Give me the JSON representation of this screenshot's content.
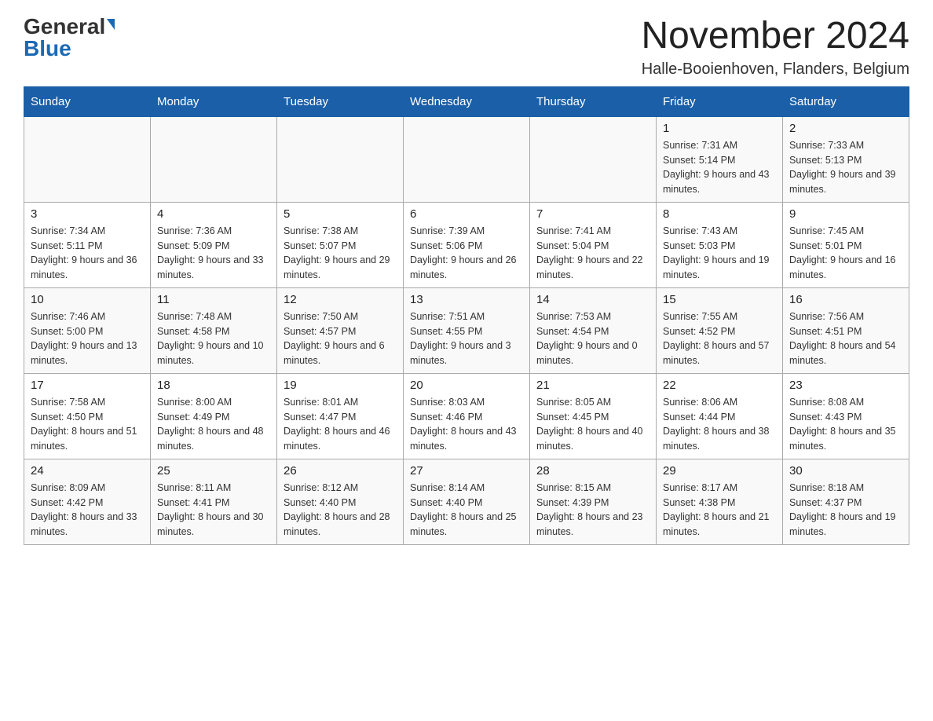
{
  "header": {
    "logo_general": "General",
    "logo_blue": "Blue",
    "month_title": "November 2024",
    "location": "Halle-Booienhoven, Flanders, Belgium"
  },
  "weekdays": [
    "Sunday",
    "Monday",
    "Tuesday",
    "Wednesday",
    "Thursday",
    "Friday",
    "Saturday"
  ],
  "weeks": [
    [
      {
        "day": "",
        "info": ""
      },
      {
        "day": "",
        "info": ""
      },
      {
        "day": "",
        "info": ""
      },
      {
        "day": "",
        "info": ""
      },
      {
        "day": "",
        "info": ""
      },
      {
        "day": "1",
        "info": "Sunrise: 7:31 AM\nSunset: 5:14 PM\nDaylight: 9 hours and 43 minutes."
      },
      {
        "day": "2",
        "info": "Sunrise: 7:33 AM\nSunset: 5:13 PM\nDaylight: 9 hours and 39 minutes."
      }
    ],
    [
      {
        "day": "3",
        "info": "Sunrise: 7:34 AM\nSunset: 5:11 PM\nDaylight: 9 hours and 36 minutes."
      },
      {
        "day": "4",
        "info": "Sunrise: 7:36 AM\nSunset: 5:09 PM\nDaylight: 9 hours and 33 minutes."
      },
      {
        "day": "5",
        "info": "Sunrise: 7:38 AM\nSunset: 5:07 PM\nDaylight: 9 hours and 29 minutes."
      },
      {
        "day": "6",
        "info": "Sunrise: 7:39 AM\nSunset: 5:06 PM\nDaylight: 9 hours and 26 minutes."
      },
      {
        "day": "7",
        "info": "Sunrise: 7:41 AM\nSunset: 5:04 PM\nDaylight: 9 hours and 22 minutes."
      },
      {
        "day": "8",
        "info": "Sunrise: 7:43 AM\nSunset: 5:03 PM\nDaylight: 9 hours and 19 minutes."
      },
      {
        "day": "9",
        "info": "Sunrise: 7:45 AM\nSunset: 5:01 PM\nDaylight: 9 hours and 16 minutes."
      }
    ],
    [
      {
        "day": "10",
        "info": "Sunrise: 7:46 AM\nSunset: 5:00 PM\nDaylight: 9 hours and 13 minutes."
      },
      {
        "day": "11",
        "info": "Sunrise: 7:48 AM\nSunset: 4:58 PM\nDaylight: 9 hours and 10 minutes."
      },
      {
        "day": "12",
        "info": "Sunrise: 7:50 AM\nSunset: 4:57 PM\nDaylight: 9 hours and 6 minutes."
      },
      {
        "day": "13",
        "info": "Sunrise: 7:51 AM\nSunset: 4:55 PM\nDaylight: 9 hours and 3 minutes."
      },
      {
        "day": "14",
        "info": "Sunrise: 7:53 AM\nSunset: 4:54 PM\nDaylight: 9 hours and 0 minutes."
      },
      {
        "day": "15",
        "info": "Sunrise: 7:55 AM\nSunset: 4:52 PM\nDaylight: 8 hours and 57 minutes."
      },
      {
        "day": "16",
        "info": "Sunrise: 7:56 AM\nSunset: 4:51 PM\nDaylight: 8 hours and 54 minutes."
      }
    ],
    [
      {
        "day": "17",
        "info": "Sunrise: 7:58 AM\nSunset: 4:50 PM\nDaylight: 8 hours and 51 minutes."
      },
      {
        "day": "18",
        "info": "Sunrise: 8:00 AM\nSunset: 4:49 PM\nDaylight: 8 hours and 48 minutes."
      },
      {
        "day": "19",
        "info": "Sunrise: 8:01 AM\nSunset: 4:47 PM\nDaylight: 8 hours and 46 minutes."
      },
      {
        "day": "20",
        "info": "Sunrise: 8:03 AM\nSunset: 4:46 PM\nDaylight: 8 hours and 43 minutes."
      },
      {
        "day": "21",
        "info": "Sunrise: 8:05 AM\nSunset: 4:45 PM\nDaylight: 8 hours and 40 minutes."
      },
      {
        "day": "22",
        "info": "Sunrise: 8:06 AM\nSunset: 4:44 PM\nDaylight: 8 hours and 38 minutes."
      },
      {
        "day": "23",
        "info": "Sunrise: 8:08 AM\nSunset: 4:43 PM\nDaylight: 8 hours and 35 minutes."
      }
    ],
    [
      {
        "day": "24",
        "info": "Sunrise: 8:09 AM\nSunset: 4:42 PM\nDaylight: 8 hours and 33 minutes."
      },
      {
        "day": "25",
        "info": "Sunrise: 8:11 AM\nSunset: 4:41 PM\nDaylight: 8 hours and 30 minutes."
      },
      {
        "day": "26",
        "info": "Sunrise: 8:12 AM\nSunset: 4:40 PM\nDaylight: 8 hours and 28 minutes."
      },
      {
        "day": "27",
        "info": "Sunrise: 8:14 AM\nSunset: 4:40 PM\nDaylight: 8 hours and 25 minutes."
      },
      {
        "day": "28",
        "info": "Sunrise: 8:15 AM\nSunset: 4:39 PM\nDaylight: 8 hours and 23 minutes."
      },
      {
        "day": "29",
        "info": "Sunrise: 8:17 AM\nSunset: 4:38 PM\nDaylight: 8 hours and 21 minutes."
      },
      {
        "day": "30",
        "info": "Sunrise: 8:18 AM\nSunset: 4:37 PM\nDaylight: 8 hours and 19 minutes."
      }
    ]
  ]
}
